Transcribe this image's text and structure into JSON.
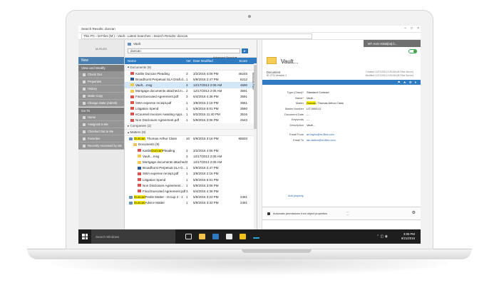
{
  "window": {
    "title": "Search Results: duncan"
  },
  "address": {
    "path": "This PC  ›  M-Files (M:)  ›  Vault  ›  Latest Searches  ›  Search Results: duncan"
  },
  "left_pane": {
    "logo_text": "M-FILES",
    "new_label": "New",
    "sections": [
      {
        "title": "View and Modify",
        "items": [
          "Check Out",
          "Properties",
          "History",
          "Make Copy",
          "Change State (Admin)"
        ]
      },
      {
        "title": "Go To",
        "items": [
          "Home",
          "Assigned to Me",
          "Checked Out to Me",
          "Favorites",
          "Recently Accessed by Me"
        ]
      }
    ]
  },
  "search": {
    "vault_label": "Vault",
    "query": "duncan",
    "advanced_label": "Advanced Search ▾",
    "go_icon": "search-go-icon"
  },
  "list": {
    "columns": {
      "name": "Name",
      "ver": "Ver.",
      "date": "Date Modified",
      "score": "Score"
    },
    "documents_group": "Documents (9)",
    "documents": [
      {
        "name_pre": "",
        "name_hl": "",
        "name_post": "Kaitlin Duncan Pleading",
        "ver": "3",
        "date": "3/2/2016 4:06 PM",
        "score": "46245",
        "icon": "pdf",
        "selected": false
      },
      {
        "name_pre": "",
        "name_hl": "",
        "name_post": "Broadhurst Perpetual SLA Draft.d...",
        "ver": "1",
        "date": "5/9/2016 2:47 PM",
        "score": "6212",
        "icon": "word",
        "selected": false
      },
      {
        "name_pre": "",
        "name_hl": "",
        "name_post": "Vault....msg",
        "ver": "3",
        "date": "12/17/2013 2:05 AM",
        "score": "4590",
        "icon": "mail",
        "selected": true
      },
      {
        "name_pre": "",
        "name_hl": "",
        "name_post": "Mortgage documents attached.m...",
        "ver": "2",
        "date": "12/17/2013 2:05 AM",
        "score": "3591",
        "icon": "mail",
        "selected": false
      },
      {
        "name_pre": "",
        "name_hl": "",
        "name_post": "Final Executed Agreement.pdf",
        "ver": "3",
        "date": "6/4/2016 4:36 PM",
        "score": "3591",
        "icon": "pdf",
        "selected": false
      },
      {
        "name_pre": "",
        "name_hl": "",
        "name_post": "SWA expense receipt.pdf",
        "ver": "1",
        "date": "3/8/2016 2:16 PM",
        "score": "3561",
        "icon": "pdf",
        "selected": false
      },
      {
        "name_pre": "",
        "name_hl": "",
        "name_post": "Litigation Spend",
        "ver": "1",
        "date": "5/9/2016 5:01 PM",
        "score": "3560",
        "icon": "pdf",
        "selected": false
      },
      {
        "name_pre": "",
        "name_hl": "",
        "name_post": "eCounsel Invoices Awaiting Appr...",
        "ver": "1",
        "date": "8/2/2016 11:40 PM",
        "score": "3516",
        "icon": "pdf",
        "selected": false
      },
      {
        "name_pre": "",
        "name_hl": "",
        "name_post": "Non Disclosure Agreement.pdf",
        "ver": "1",
        "date": "5/9/2016 3:06 PM",
        "score": "2543",
        "icon": "pdf",
        "selected": false
      }
    ],
    "companies_group": "Companies (2)",
    "matters_group": "Matters (9)",
    "matters": [
      {
        "name_pre": "",
        "name_hl": "Duncan",
        "name_post": ", Thomas Arthur Claim",
        "ver": "10",
        "date": "5/9/2016 3:16 PM",
        "score": "95503",
        "icon": "matter",
        "indent": 0
      },
      {
        "name_pre": "",
        "name_hl": "",
        "name_post": "Documents (9)",
        "ver": "",
        "date": "",
        "score": "",
        "icon": "folder",
        "indent": 1
      },
      {
        "name_pre": "Kaitlin ",
        "name_hl": "Duncan",
        "name_post": " Pleading",
        "ver": "3",
        "date": "3/2/2016 4:06 PM",
        "score": "",
        "icon": "pdf",
        "indent": 2
      },
      {
        "name_pre": "",
        "name_hl": "",
        "name_post": "Vault....msg",
        "ver": "3",
        "date": "12/17/2013 2:05 AM",
        "score": "",
        "icon": "mail",
        "indent": 2
      },
      {
        "name_pre": "",
        "name_hl": "",
        "name_post": "Mortgage documents attached...",
        "ver": "2",
        "date": "12/17/2013 2:05 AM",
        "score": "",
        "icon": "mail",
        "indent": 2
      },
      {
        "name_pre": "",
        "name_hl": "",
        "name_post": "Broadhurst Perpetual SLA D...",
        "ver": "1",
        "date": "5/9/2016 2:47 PM",
        "score": "",
        "icon": "word",
        "indent": 2
      },
      {
        "name_pre": "",
        "name_hl": "",
        "name_post": "SWA expense receipt.pdf",
        "ver": "1",
        "date": "3/8/2016 2:16 PM",
        "score": "",
        "icon": "pdf",
        "indent": 2
      },
      {
        "name_pre": "",
        "name_hl": "",
        "name_post": "Litigation Spend",
        "ver": "1",
        "date": "5/9/2016 5:01 PM",
        "score": "",
        "icon": "pdf",
        "indent": 2
      },
      {
        "name_pre": "",
        "name_hl": "",
        "name_post": "Non Disclosure Agreement...",
        "ver": "1",
        "date": "5/9/2016 3:06 PM",
        "score": "",
        "icon": "pdf",
        "indent": 2
      },
      {
        "name_pre": "",
        "name_hl": "",
        "name_post": "Final Executed Agreement.pdf",
        "ver": "3",
        "date": "6/4/2016 4:36 PM",
        "score": "",
        "icon": "pdf",
        "indent": 2
      },
      {
        "name_pre": "",
        "name_hl": "Duncan",
        "name_post": " Pestle Matter - Group 2 - 1",
        "ver": "1",
        "date": "5/9/2016 3:23 PM",
        "score": "2491",
        "icon": "matter",
        "indent": 0
      },
      {
        "name_pre": "",
        "name_hl": "Duncan",
        "name_post": " Advice Matter",
        "ver": "1",
        "date": "5/9/2016 3:33 PM",
        "score": "2491",
        "icon": "matter",
        "indent": 0
      }
    ]
  },
  "metadata": {
    "tab_label": "Metadata Pane",
    "vault_tag": "MT-AUS-X368(lat).b...",
    "title": "Vault...",
    "doc_type": "Document",
    "doc_id": "ID 273  Version 1",
    "created": "Created 12/17/2013 2:05 AM (M-Files Server)",
    "modified": "Modified 12/17/2013 2:05 AM (M-Files Server)",
    "properties": [
      {
        "label": "Type (Class)*",
        "value": "Standard Contract"
      },
      {
        "label": "Name*",
        "value": "Vault..."
      },
      {
        "label": "Matter",
        "value_hl": "Duncan",
        "value": ", Thomas Arthur Claim"
      },
      {
        "label": "Matter Number",
        "value": "LIT-0009-11"
      },
      {
        "label": "Document Date",
        "value": "---"
      },
      {
        "label": "Keywords",
        "value": "---"
      },
      {
        "label": "Description",
        "value": "Vault..."
      }
    ],
    "email_rows": [
      {
        "label": "Email From",
        "value": "ari.taylor@m-files.com"
      },
      {
        "label": "Email To",
        "value": "ian.dalton@m-files.com"
      }
    ],
    "add_property": "Add property",
    "auto_permissions": "Automatic permissions from object properties"
  },
  "status": {
    "items_count": "18 items",
    "selected": "1 item selected"
  },
  "taskbar": {
    "search_placeholder": "Search Windows",
    "time": "3:05 PM",
    "date": "9/21/2016"
  },
  "colors": {
    "accent": "#2f7bc2",
    "taskbar": "#1e1e1e",
    "highlight": "#fff200",
    "selection": "#d3e7f8"
  }
}
